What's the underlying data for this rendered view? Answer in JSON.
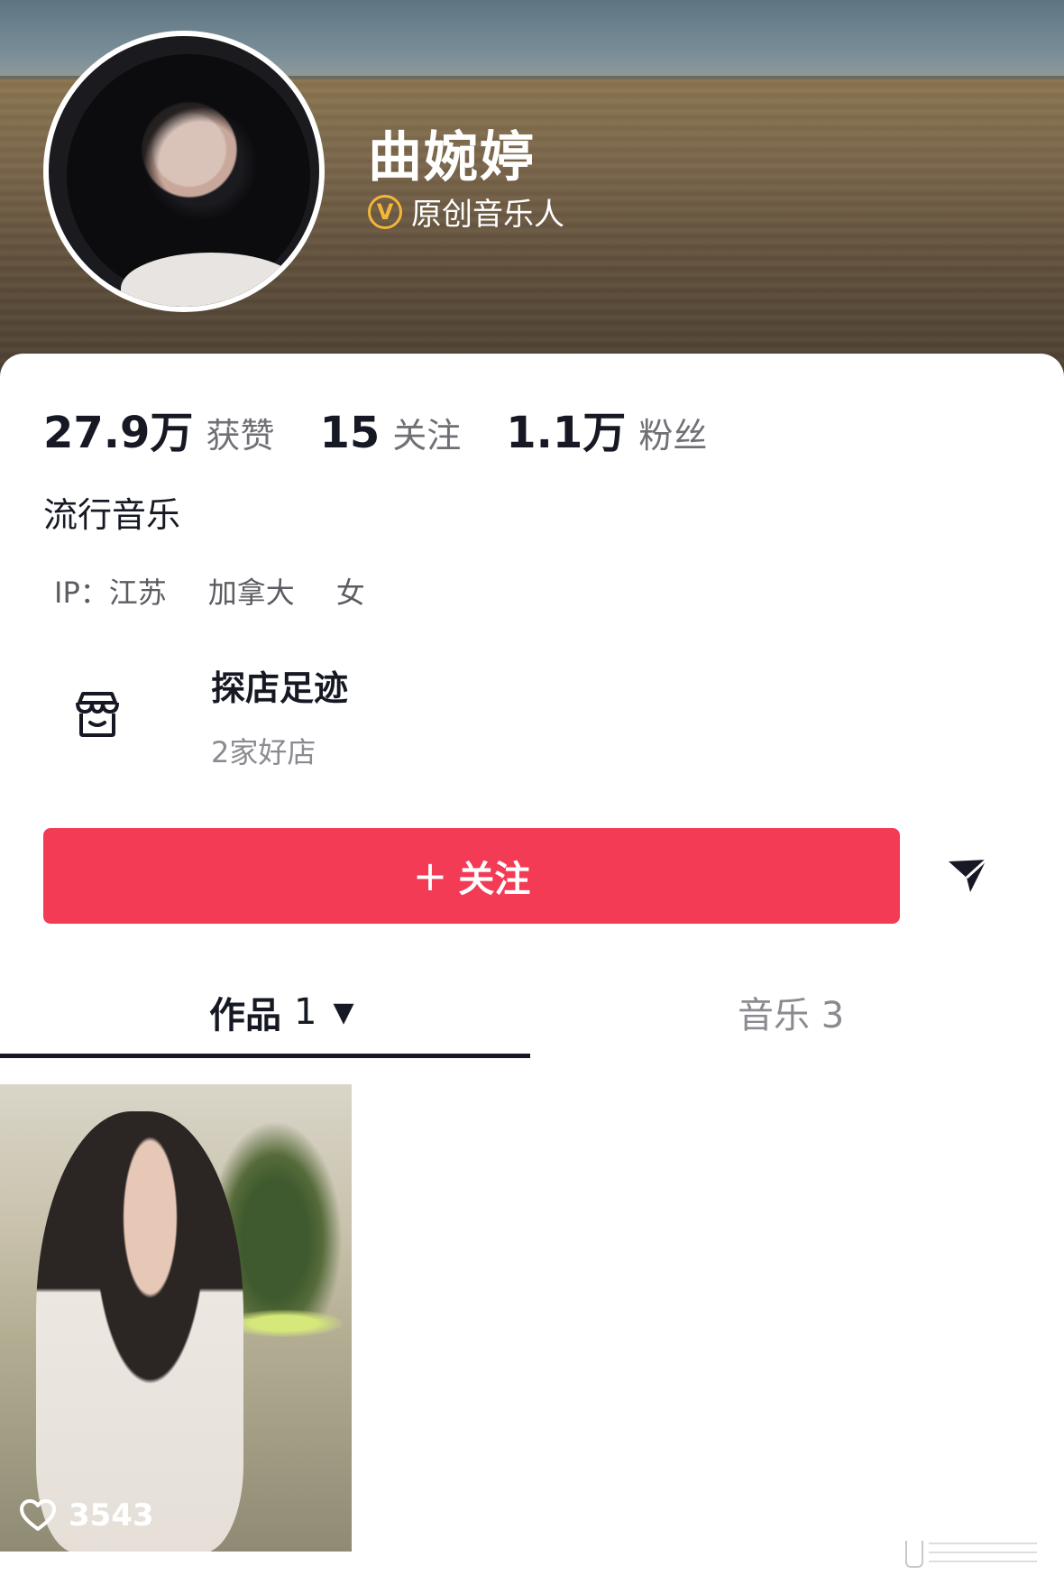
{
  "profile": {
    "name": "曲婉婷",
    "verification": "原创音乐人",
    "verify_icon": "verified-v-icon",
    "accent_color": "#f4b63a"
  },
  "stats": [
    {
      "value": "27.9万",
      "label": "获赞"
    },
    {
      "value": "15",
      "label": "关注"
    },
    {
      "value": "1.1万",
      "label": "粉丝"
    }
  ],
  "bio": "流行音乐",
  "tags": {
    "ip": "IP：江苏",
    "location": "加拿大",
    "gender": "女"
  },
  "shop": {
    "icon": "storefront-icon",
    "title": "探店足迹",
    "subtitle": "2家好店"
  },
  "actions": {
    "follow_plus": "+",
    "follow_label": "关注",
    "follow_color": "#f33b55",
    "share_icon": "send-icon"
  },
  "tabs": {
    "works_label": "作品",
    "works_count": "1",
    "works_caret": "▼",
    "music_label": "音乐 3"
  },
  "videos": [
    {
      "likes": "3543",
      "icon": "heart-icon"
    }
  ]
}
